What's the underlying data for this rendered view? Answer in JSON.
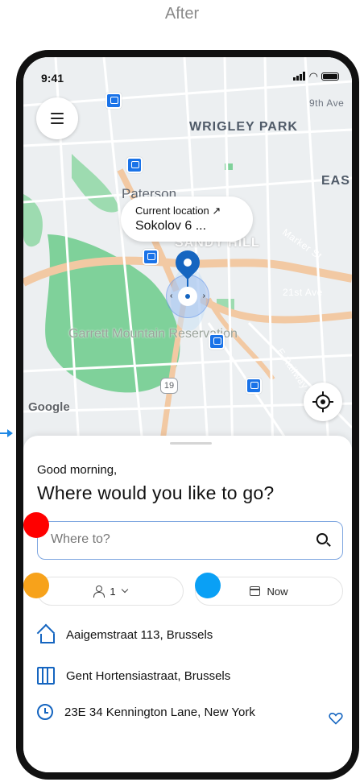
{
  "caption": "After",
  "status_bar": {
    "time": "9:41"
  },
  "map": {
    "labels": {
      "wrigley_park": "WRIGLEY PARK",
      "paterson": "Paterson",
      "east": "EAS",
      "sandy_hill": "SANDY HILL",
      "garrett": "Garrett Mountain Reservation",
      "ninth_ave": "9th Ave",
      "twenty_first_ave": "21st Ave",
      "marker_st": "Marker St",
      "railway_ave": "E Railway Ave",
      "route": "19",
      "google": "Google"
    },
    "callout": {
      "title": "Current location ↗",
      "address": "Sokolov 6 ..."
    }
  },
  "sheet": {
    "greeting": "Good morning,",
    "headline": "Where would you like to go?",
    "search": {
      "placeholder": "Where to?"
    },
    "passengers": {
      "value": "1"
    },
    "time": {
      "label": "Now"
    },
    "recent": [
      {
        "label": "Aaigemstraat 113, Brussels",
        "icon": "home-icon"
      },
      {
        "label": "Gent Hortensiastraat, Brussels",
        "icon": "building-icon"
      },
      {
        "label": "23E 34 Kennington Lane, New York",
        "icon": "clock-icon",
        "favorite": true
      }
    ]
  },
  "colors": {
    "accent": "#1565c0",
    "marker_red": "#ff0000",
    "marker_orange": "#f7a21b",
    "marker_blue": "#0aa0f5"
  }
}
